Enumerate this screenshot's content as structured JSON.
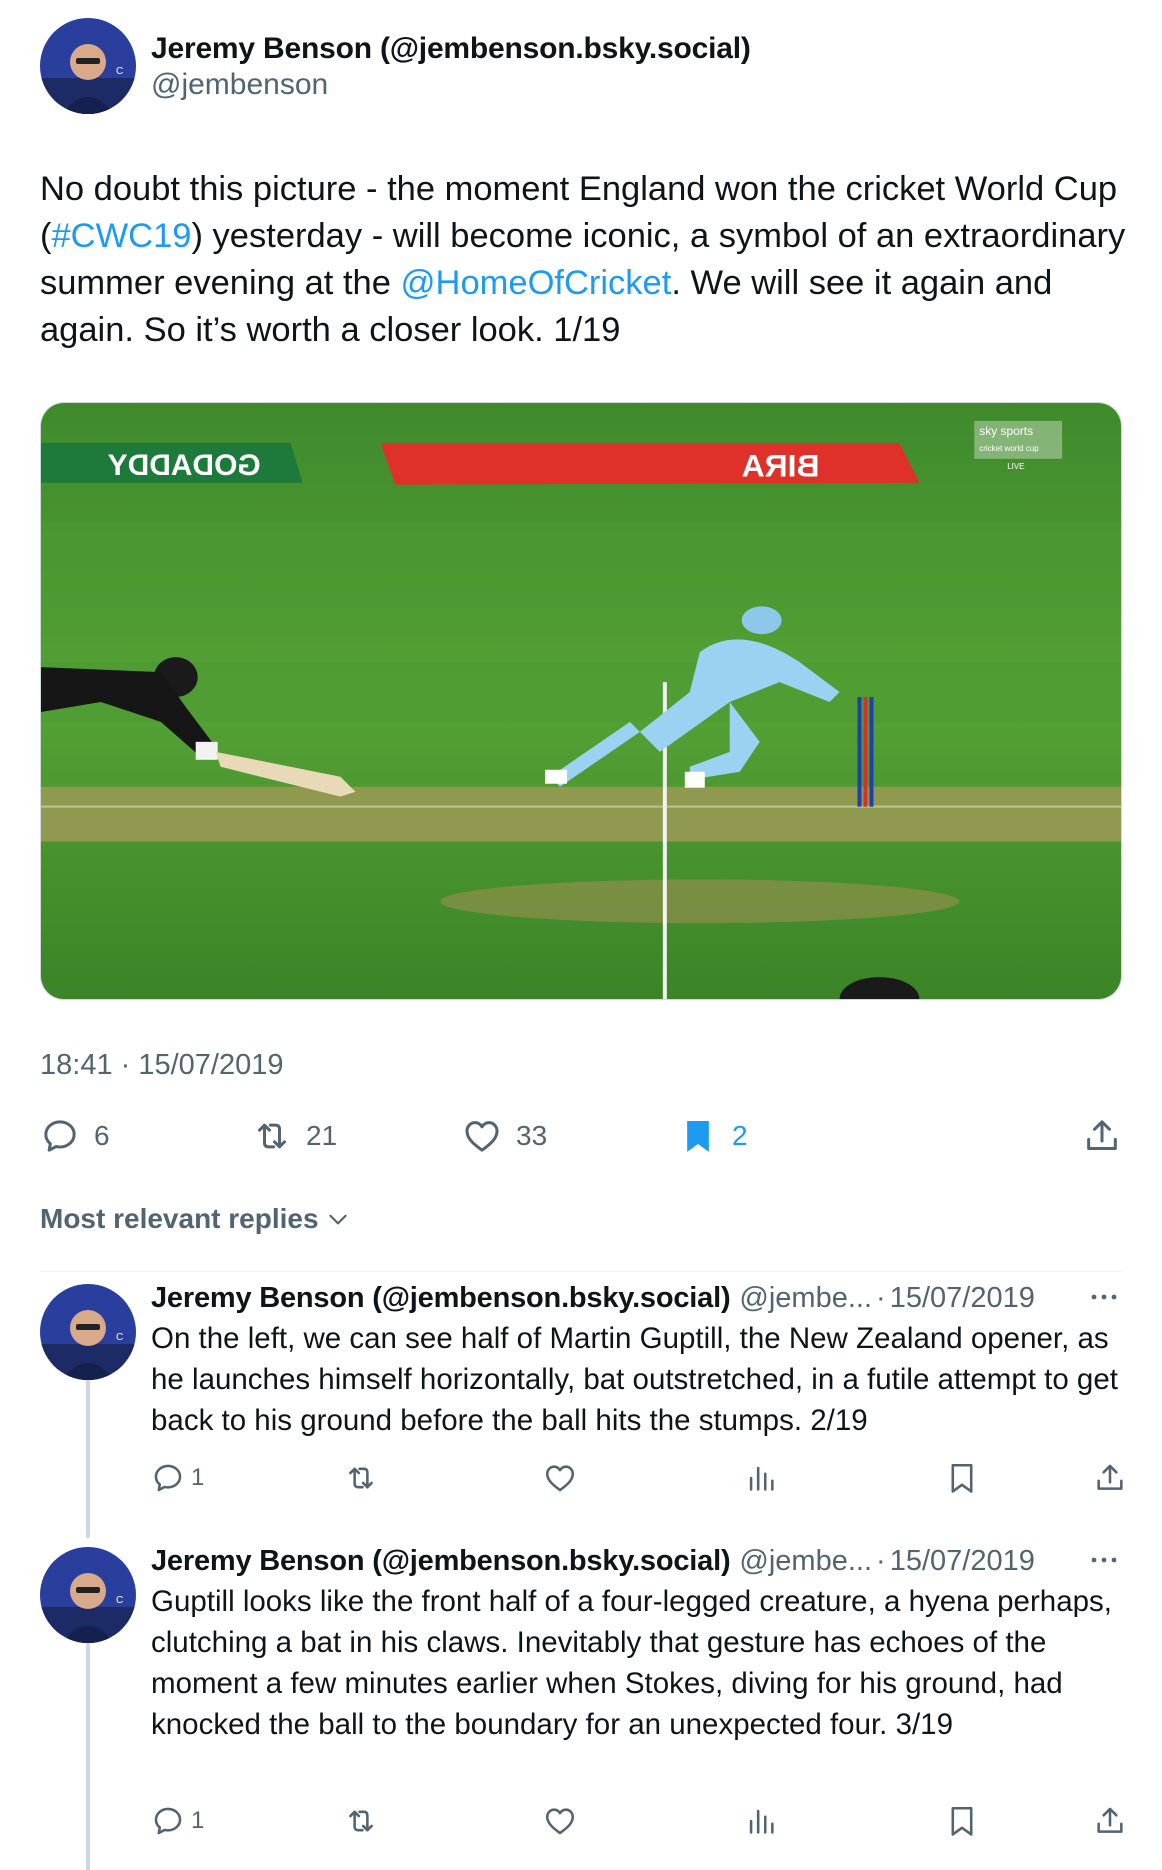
{
  "post": {
    "author_name": "Jeremy Benson (@jembenson.bsky.social)",
    "author_handle": "@jembenson",
    "text_part1": "No doubt this picture - the moment England won the cricket World Cup (",
    "hashtag": "#CWC19",
    "text_part2": ") yesterday - will become iconic, a symbol of an extraordinary summer evening at the ",
    "mention": "@HomeOfCricket",
    "text_part3": ". We will see it again and again. So it’s worth a closer look. 1/19",
    "timestamp": "18:41 · 15/07/2019",
    "media": {
      "broadcaster_logo_text": "sky sports",
      "broadcaster_sub_text": "cricket world cup",
      "live_text": "LIVE"
    },
    "actions": {
      "replies": "6",
      "reposts": "21",
      "likes": "33",
      "bookmarks": "2"
    }
  },
  "replies_filter": {
    "label": "Most relevant replies"
  },
  "replies": [
    {
      "author_name": "Jeremy Benson (@jembenson.bsky.social)",
      "handle": "@jembe...",
      "separator": "·",
      "date": "15/07/2019",
      "text": "On the left, we can see half of Martin Guptill, the New Zealand opener, as he launches himself horizontally, bat outstretched, in a futile attempt to get back to his ground before the ball hits the stumps. 2/19",
      "reply_count": "1"
    },
    {
      "author_name": "Jeremy Benson (@jembenson.bsky.social)",
      "handle": "@jembe...",
      "separator": "·",
      "date": "15/07/2019",
      "text": "Guptill looks like the front half of a four-legged creature, a hyena perhaps, clutching a bat in his claws. Inevitably that gesture has echoes of the moment a few minutes earlier when Stokes, diving for his ground, had knocked the ball to the boundary for an unexpected four. 3/19",
      "reply_count": "1"
    }
  ],
  "colors": {
    "accent": "#1d9bf0",
    "secondary_text": "#536471",
    "primary_text": "#0f1419"
  },
  "icons": {
    "reply": "reply-icon",
    "repost": "repost-icon",
    "like": "heart-icon",
    "bookmark": "bookmark-icon",
    "share": "share-icon",
    "views": "views-icon",
    "more": "more-icon",
    "chevron": "chevron-down-icon"
  }
}
